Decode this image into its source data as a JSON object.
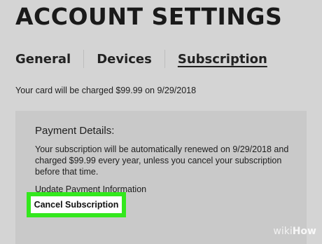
{
  "header": {
    "title": "ACCOUNT SETTINGS"
  },
  "tabs": [
    {
      "label": "General",
      "active": false
    },
    {
      "label": "Devices",
      "active": false
    },
    {
      "label": "Subscription",
      "active": true
    }
  ],
  "charge_note": "Your card will be charged $99.99 on 9/29/2018",
  "payment": {
    "heading": "Payment Details:",
    "description": "Your subscription will be automatically renewed on 9/29/2018 and charged $99.99 every year, unless you cancel your subscription before that time.",
    "update_link": "Update Payment Information",
    "cancel_button": "Cancel Subscription"
  },
  "watermark": {
    "prefix": "wiki",
    "suffix": "How"
  },
  "colors": {
    "background": "#d4d4d4",
    "panel": "#c9c9c9",
    "highlight": "#33e81d"
  }
}
